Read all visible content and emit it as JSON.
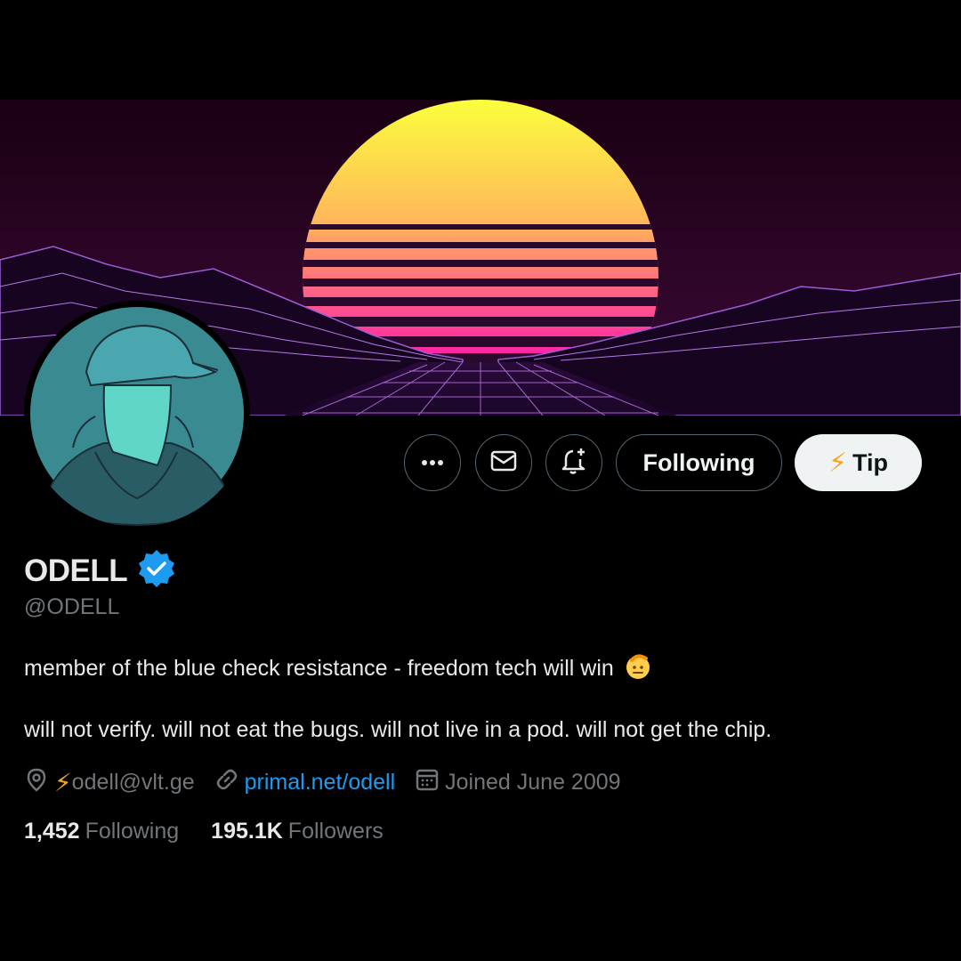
{
  "profile": {
    "display_name": "ODELL",
    "handle": "@ODELL",
    "verified_badge_icon": "verified-badge-icon",
    "bio_line1": "member of the blue check resistance - freedom tech will win",
    "bio_line1_emoji": "saluting-face-emoji",
    "bio_line2": "will not verify. will not eat the bugs. will not live in a pod. will not get the chip.",
    "location_icon": "location-pin-icon",
    "location_bolt": "⚡",
    "location_text": "odell@vlt.ge",
    "link_icon": "link-icon",
    "link_text": "primal.net/odell",
    "joined_icon": "calendar-icon",
    "joined_text": "Joined June 2009",
    "following_count": "1,452",
    "following_label": "Following",
    "followers_count": "195.1K",
    "followers_label": "Followers"
  },
  "actions": {
    "more_icon": "more-dots-icon",
    "message_icon": "envelope-icon",
    "notify_icon": "bell-plus-icon",
    "following_label": "Following",
    "tip_bolt": "⚡",
    "tip_label": "Tip"
  },
  "colors": {
    "background": "#000000",
    "accent_link": "#1d9bf0",
    "muted_text": "#71767b",
    "verified_blue": "#1d9bf0",
    "bolt": "#f5a524"
  }
}
